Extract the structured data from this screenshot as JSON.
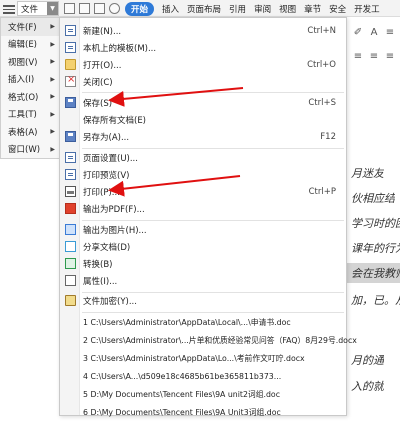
{
  "topbar": {
    "file_label": "文件",
    "tabs": [
      "开始",
      "插入",
      "页面布局",
      "引用",
      "审阅",
      "视图",
      "章节",
      "安全",
      "开发工"
    ]
  },
  "left_menu": [
    {
      "label": "文件(F)"
    },
    {
      "label": "编辑(E)"
    },
    {
      "label": "视图(V)"
    },
    {
      "label": "插入(I)"
    },
    {
      "label": "格式(O)"
    },
    {
      "label": "工具(T)"
    },
    {
      "label": "表格(A)"
    },
    {
      "label": "窗口(W)"
    }
  ],
  "file_menu": {
    "new": {
      "label": "新建(N)...",
      "shortcut": "Ctrl+N"
    },
    "template": {
      "label": "本机上的模板(M)..."
    },
    "open": {
      "label": "打开(O)...",
      "shortcut": "Ctrl+O"
    },
    "close": {
      "label": "关闭(C)"
    },
    "save": {
      "label": "保存(S)",
      "shortcut": "Ctrl+S"
    },
    "save_all": {
      "label": "保存所有文档(E)"
    },
    "save_as": {
      "label": "另存为(A)...",
      "shortcut": "F12"
    },
    "page_setup": {
      "label": "页面设置(U)..."
    },
    "print_preview": {
      "label": "打印预览(V)"
    },
    "print": {
      "label": "打印(P)...",
      "shortcut": "Ctrl+P"
    },
    "export_pdf": {
      "label": "输出为PDF(F)..."
    },
    "export_image": {
      "label": "输出为图片(H)..."
    },
    "share": {
      "label": "分享文档(D)"
    },
    "convert": {
      "label": "转换(B)"
    },
    "properties": {
      "label": "属性(I)..."
    },
    "encrypt": {
      "label": "文件加密(Y)..."
    }
  },
  "recent_files": [
    "1 C:\\Users\\Administrator\\AppData\\Local\\...\\申请书.doc",
    "2 C:\\Users\\Administrator\\...片单和优质经验常见问答（FAQ）8月29号.docx",
    "3 C:\\Users\\Administrator\\AppData\\Lo...\\考前作文叮咛.docx",
    "4 C:\\Users\\A...\\d509e18c4685b61be365811b373...",
    "5 D:\\My Documents\\Tencent Files\\9A unit2词组.doc",
    "6 D:\\My Documents\\Tencent Files\\9A Unit3词组.doc"
  ],
  "document_text": [
    "月迷友",
    "伙相应结",
    "学习时的困",
    "课年的行为",
    "会在我教师",
    "加，已。从",
    "月的通",
    "入的就"
  ],
  "colors": {
    "accent": "#2e7ad8",
    "arrow": "#e01010"
  }
}
